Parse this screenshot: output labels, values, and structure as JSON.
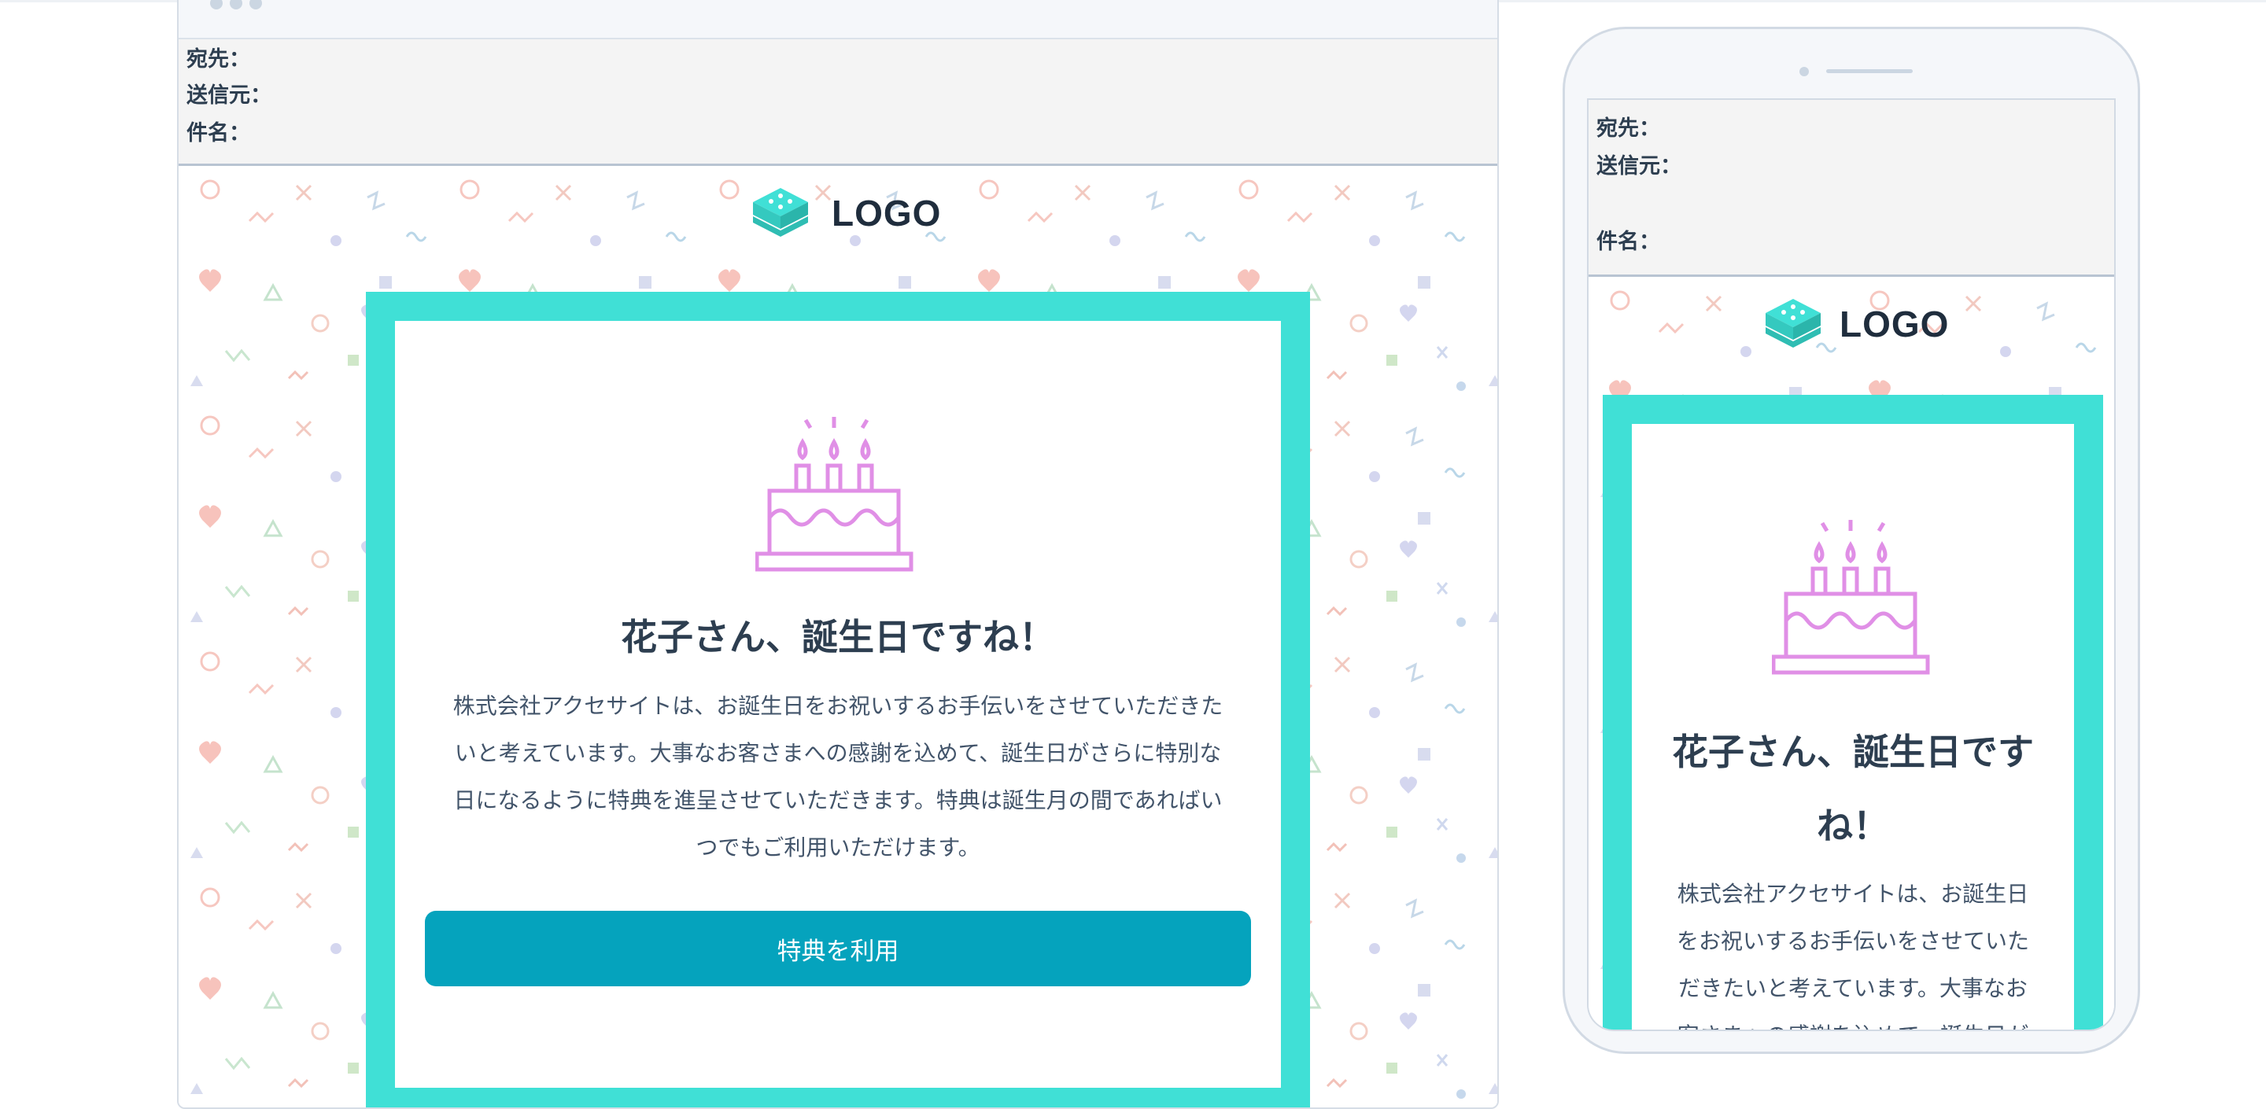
{
  "email": {
    "header_labels": {
      "to": "宛先：",
      "from": "送信元：",
      "subject": "件名："
    },
    "logo_text": "LOGO",
    "heading": "花子さん、誕生日ですね！",
    "body": "株式会社アクセサイトは、お誕生日をお祝いするお手伝いをさせていただきたいと考えています。大事なお客さまへの感謝を込めて、誕生日がさらに特別な日になるように特典を進呈させていただきます。特典は誕生月の間であればいつでもご利用いただけます。",
    "button_label": "特典を利用"
  },
  "desktop": {
    "body_lines": [
      "株式会社アクセサイトは、お誕生日をお祝いするお手伝いをさせていただきた",
      "いと考えています。大事なお客さまへの感謝を込めて、誕生日がさらに特別な",
      "日になるように特典を進呈させていただきます。特典は誕生月の間であればい",
      "つでもご利用いただけます。"
    ]
  },
  "mobile": {
    "heading_lines": [
      "花子さん、誕生日です",
      "ね！"
    ],
    "body_lines": [
      "株式会社アクセサイトは、お誕生日",
      "をお祝いするお手伝いをさせていた",
      "だきたいと考えています。大事なお",
      "客さまへの感謝を込めて、誕生日が"
    ]
  },
  "colors": {
    "frame": "#40e0d6",
    "button": "#05a3bd",
    "cake": "#e08fe6",
    "logo_icon": "#40cfc4",
    "heading": "#2d3e50"
  },
  "icons": {
    "logo": "stacked-cube-logo-icon",
    "cake": "birthday-cake-icon"
  }
}
